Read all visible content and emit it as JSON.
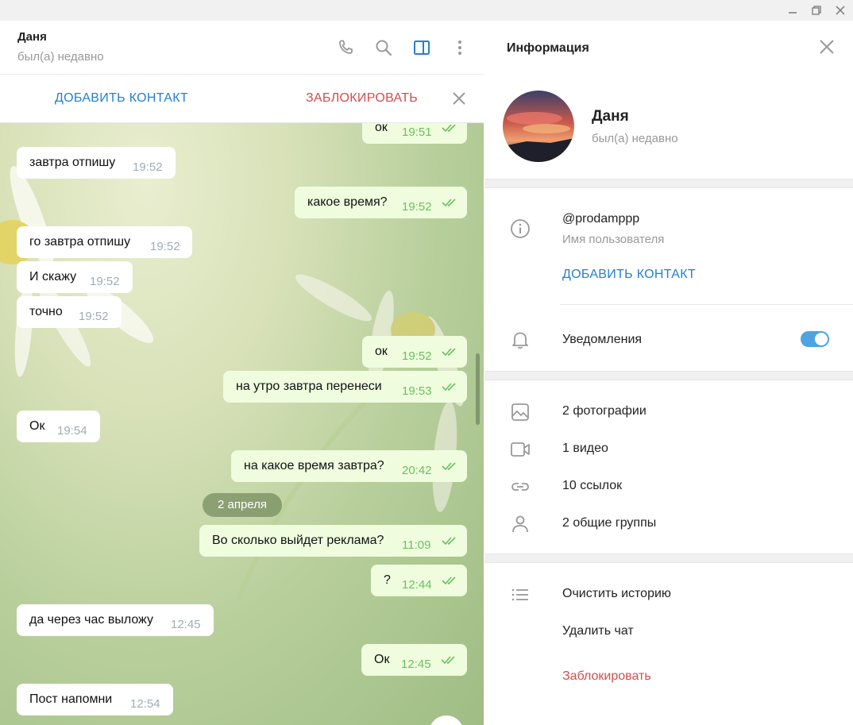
{
  "chat": {
    "name": "Даня",
    "status": "был(а) недавно",
    "add_contact": "ДОБАВИТЬ КОНТАКТ",
    "block": "ЗАБЛОКИРОВАТЬ",
    "date_divider": "2 апреля",
    "messages": [
      {
        "dir": "out",
        "text": "ок",
        "time": "19:51",
        "read": true
      },
      {
        "dir": "in",
        "text": "завтра отпишу",
        "time": "19:52"
      },
      {
        "dir": "out",
        "text": "какое время?",
        "time": "19:52",
        "read": true
      },
      {
        "dir": "in",
        "text": "го завтра отпишу",
        "time": "19:52"
      },
      {
        "dir": "in",
        "text": "И скажу",
        "time": "19:52"
      },
      {
        "dir": "in",
        "text": "точно",
        "time": "19:52"
      },
      {
        "dir": "out",
        "text": "ок",
        "time": "19:52",
        "read": true
      },
      {
        "dir": "out",
        "text": "на утро завтра перенеси",
        "time": "19:53",
        "read": true
      },
      {
        "dir": "in",
        "text": "Ок",
        "time": "19:54"
      },
      {
        "dir": "out",
        "text": "на какое время завтра?",
        "time": "20:42",
        "read": true
      },
      {
        "dir": "out",
        "text": "Во сколько выйдет реклама?",
        "time": "11:09",
        "read": true
      },
      {
        "dir": "out",
        "text": "?",
        "time": "12:44",
        "read": true
      },
      {
        "dir": "in",
        "text": "да через час выложу",
        "time": "12:45"
      },
      {
        "dir": "out",
        "text": "Ок",
        "time": "12:45",
        "read": true
      },
      {
        "dir": "in",
        "text": "Пост напомни",
        "time": "12:54"
      }
    ]
  },
  "info": {
    "title": "Информация",
    "name": "Даня",
    "status": "был(а) недавно",
    "username": "@prodamppp",
    "username_label": "Имя пользователя",
    "add_contact": "ДОБАВИТЬ КОНТАКТ",
    "notifications": "Уведомления",
    "notifications_on": true,
    "media": {
      "photos": "2 фотографии",
      "videos": "1 видео",
      "links": "10 ссылок",
      "groups": "2 общие группы"
    },
    "actions": {
      "clear_history": "Очистить историю",
      "delete_chat": "Удалить чат",
      "block": "Заблокировать"
    }
  },
  "colors": {
    "accent": "#2481cc",
    "danger": "#d14e4e",
    "outgoing_bubble": "#effdde",
    "read_ticks": "#6cbf61",
    "toggle_on": "#4fa3e1"
  }
}
